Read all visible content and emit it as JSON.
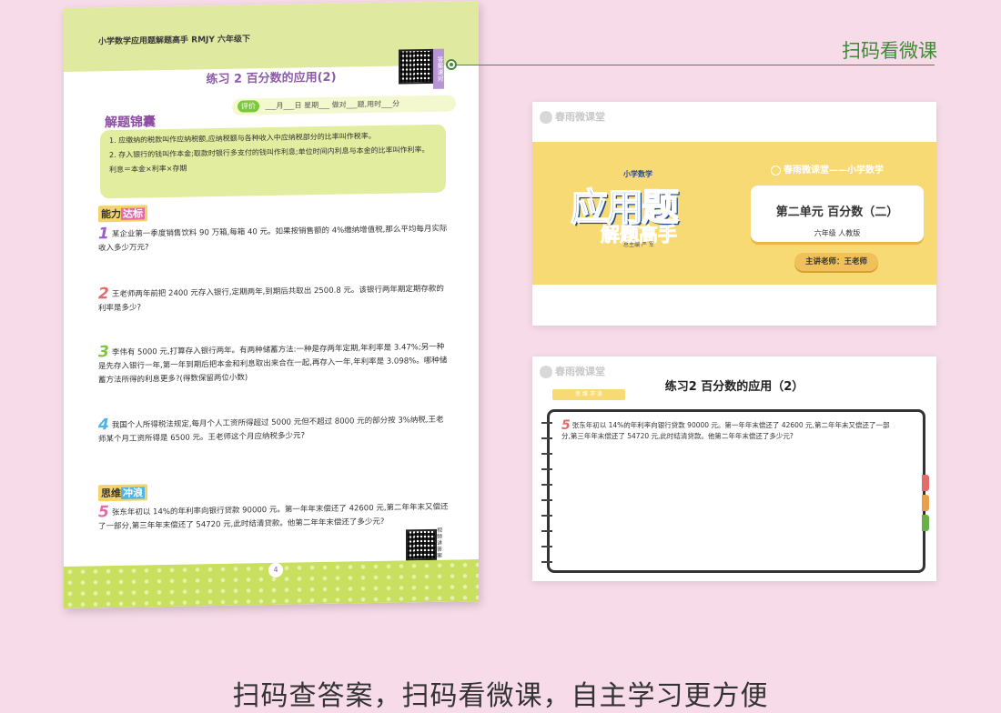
{
  "workbook": {
    "header": "小学数学应用题解题高手  RMJY  六年级下",
    "qr_tag": "答案速对",
    "title": "练习 2   百分数的应用(2)",
    "pingjia_badge": "评价",
    "pingjia_text": "___月___日  星期___    做对___题,用时___分",
    "tips_title": "解题锦囊",
    "tips": [
      "1. 应缴纳的税款叫作应纳税额,应纳税额与各种收入中应纳税部分的比率叫作税率。",
      "2. 存入银行的钱叫作本金;取款时银行多支付的钱叫作利息;单位时间内利息与本金的比率叫作利率。",
      "利息＝本金×利率×存期"
    ],
    "section1": {
      "a": "能力",
      "b": "达标"
    },
    "section2": {
      "a": "思维",
      "b": "冲浪"
    },
    "questions": [
      {
        "num": "1",
        "text": "某企业第一季度销售饮料 90 万箱,每箱 40 元。如果按销售额的 4%缴纳增值税,那么平均每月实际收入多少万元?"
      },
      {
        "num": "2",
        "text": "王老师两年前把 2400 元存入银行,定期两年,到期后共取出 2500.8 元。该银行两年期定期存款的利率是多少?"
      },
      {
        "num": "3",
        "text": "李伟有 5000 元,打算存入银行两年。有两种储蓄方法:一种是存两年定期,年利率是 3.47%;另一种是先存入银行一年,第一年到期后把本金和利息取出来合在一起,再存入一年,年利率是 3.098%。哪种储蓄方法所得的利息更多?(得数保留两位小数)"
      },
      {
        "num": "4",
        "text": "我国个人所得税法规定,每月个人工资所得超过 5000 元但不超过 8000 元的部分按 3%纳税,王老师某个月工资所得是 6500 元。王老师这个月应纳税多少元?"
      },
      {
        "num": "5",
        "text": "张东年初以 14%的年利率向银行贷款 90000 元。第一年年末偿还了 42600 元,第二年年末又偿还了一部分,第三年年末偿还了 54720 元,此时结清贷款。他第二年年末偿还了多少元?"
      }
    ],
    "qr_bottom_tag": "视频讲答案",
    "page_number": "4"
  },
  "connector_label": "扫码看微课",
  "video1": {
    "brand": "春雨微课堂",
    "small_title": "小学数学",
    "big_title": "应用题",
    "big_subtitle": "解题高手",
    "author": "总主编  严 军",
    "series": "春雨微课堂——小学数学",
    "unit": "第二单元  百分数（二）",
    "grade": "六年级  人教版",
    "teacher": "主讲老师：王老师"
  },
  "video2": {
    "brand": "春雨微课堂",
    "title": "练习2   百分数的应用（2）",
    "tag": "思  维  冲  浪",
    "q_num": "5",
    "q_text": "张东年初以 14%的年利率向银行贷款 90000 元。第一年年末偿还了 42600 元,第二年年末又偿还了一部分,第三年年末偿还了 54720 元,此时结清贷款。他第二年年末偿还了多少元?"
  },
  "caption": "扫码查答案，扫码看微课，自主学习更方便",
  "colors": {
    "background": "#f7dbe8",
    "accent_green": "#3e8a35",
    "band_yellow": "#f8da74",
    "title_blue": "#2f79c8"
  }
}
